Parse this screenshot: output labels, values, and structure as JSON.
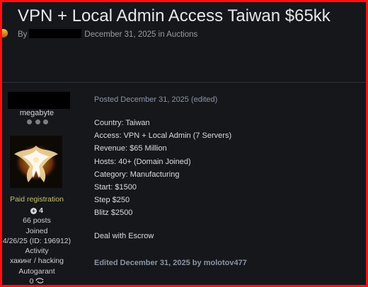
{
  "topic": {
    "title": "VPN + Local Admin Access Taiwan $65kk",
    "by_label": "By",
    "date": "December 31, 2025",
    "in_label": "in",
    "forum": "Auctions"
  },
  "author": {
    "name": "megabyte",
    "group": "Paid registration",
    "reputation": "4",
    "posts": "66 posts",
    "joined_label": "Joined",
    "joined_value": "4/26/25 (ID: 196912)",
    "activity_label": "Activity",
    "activity_value": "хакинг / hacking",
    "status": "Autogarant",
    "reaction_count": "0"
  },
  "post": {
    "posted": "Posted December 31, 2025 (edited)",
    "lines": [
      "Country: Taiwan",
      "Access: VPN + Local Admin (7 Servers)",
      "Revenue: $65 Million",
      "Hosts: 40+ (Domain Joined)",
      "Category: Manufacturing",
      "Start: $1500",
      "Step $250",
      "Blitz $2500"
    ],
    "escrow": "Deal with Escrow",
    "edited": "Edited December 31, 2025 by molotov477"
  },
  "colors": {
    "border": "#ff1010",
    "background": "#16171b",
    "muted_blue": "#8a94a8",
    "group_gold": "#c9c06b"
  }
}
